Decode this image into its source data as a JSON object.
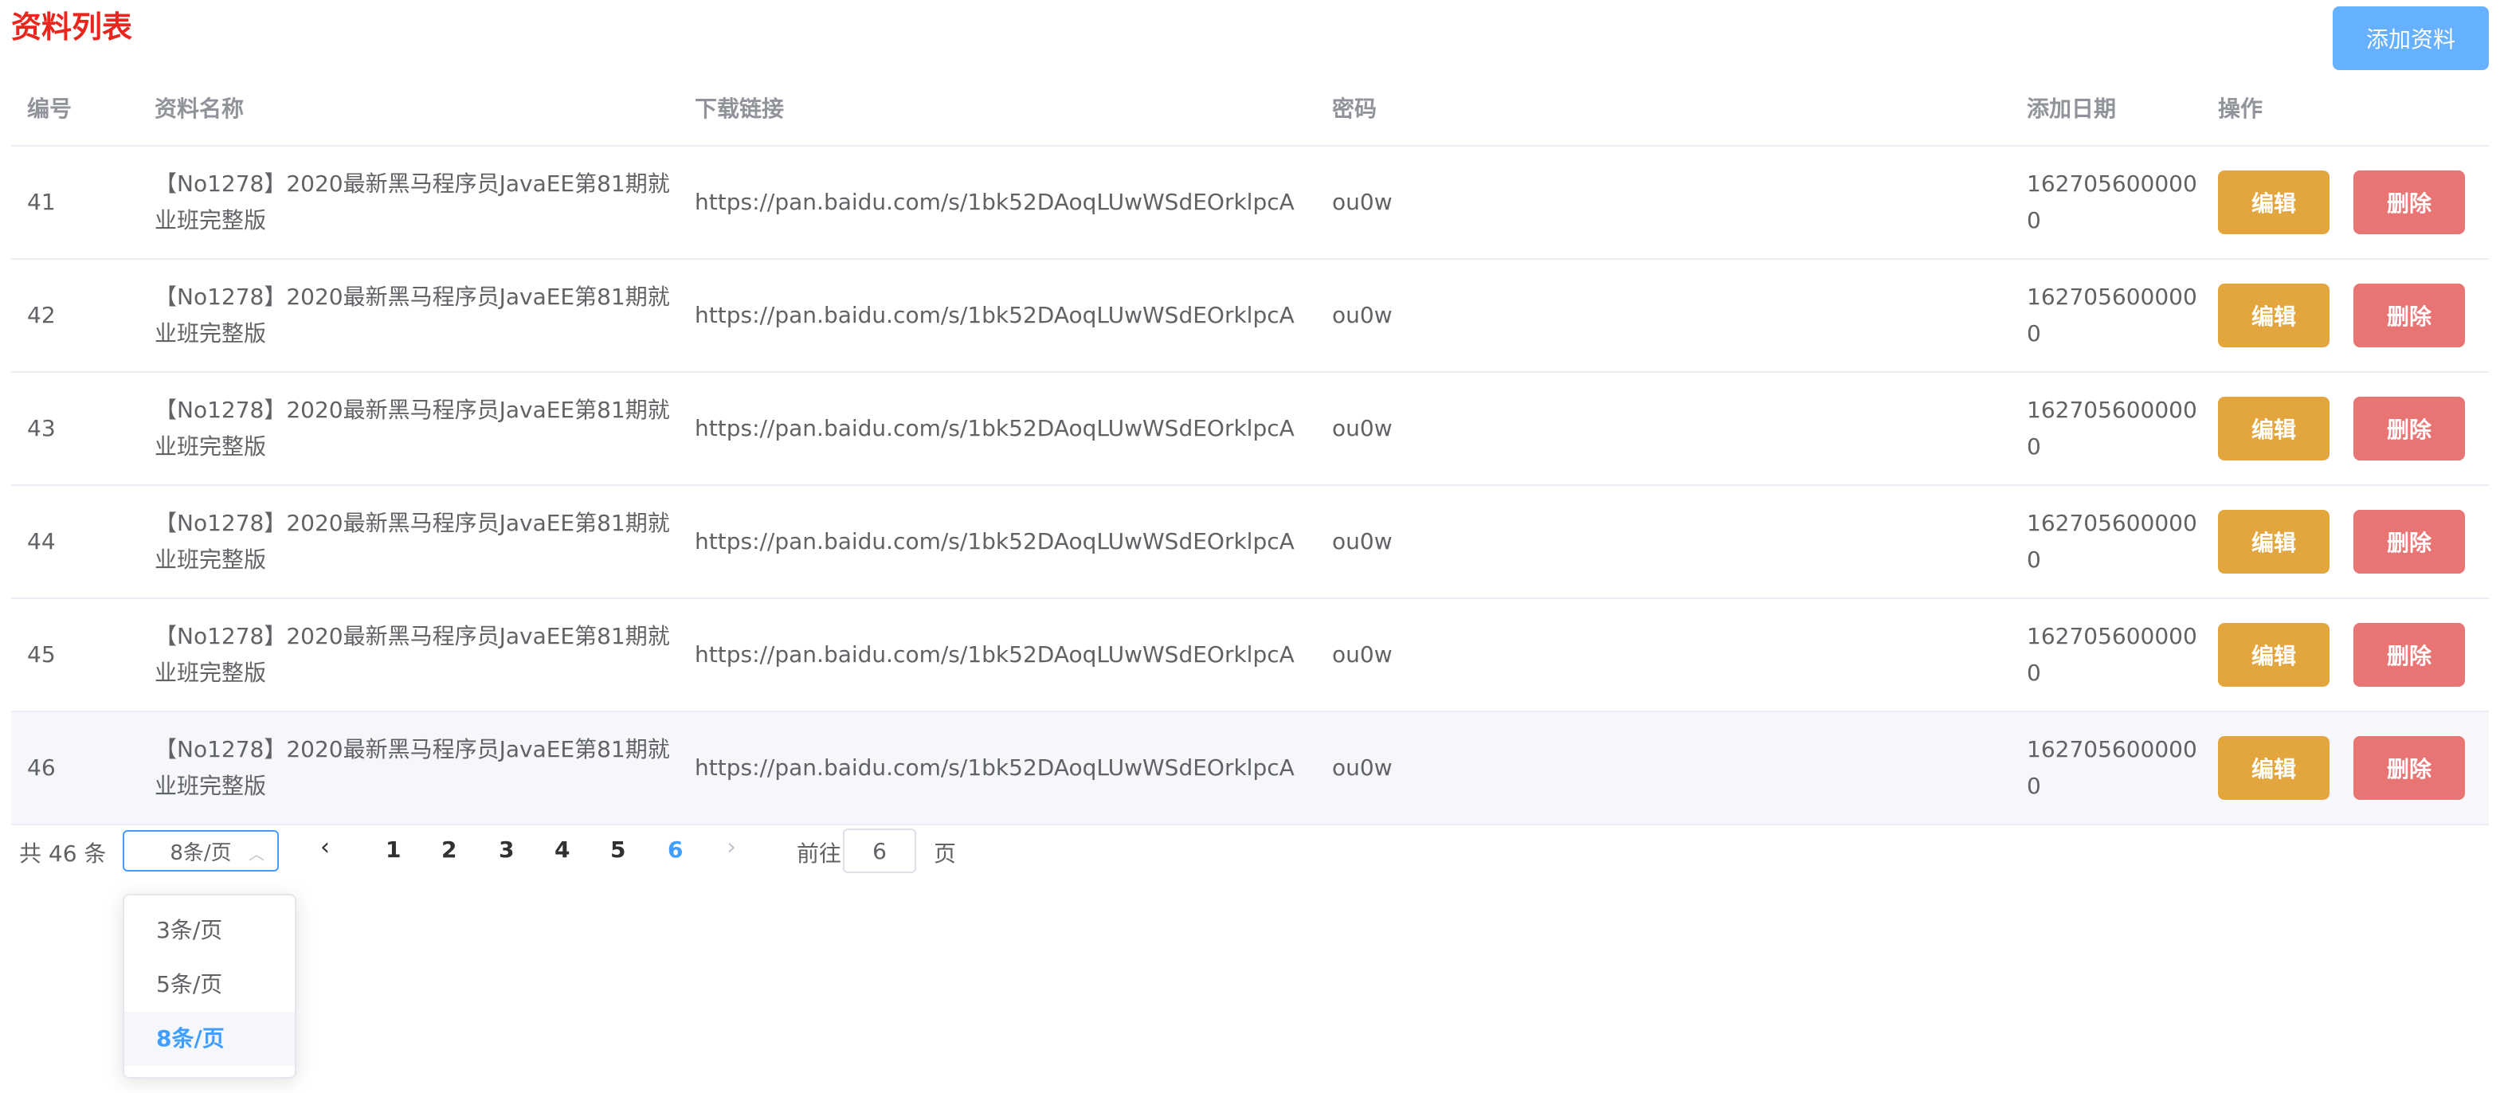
{
  "page_title": "资料列表",
  "add_button_label": "添加资料",
  "colors": {
    "title": "#e8261d",
    "primary": "#409eff",
    "add_button": "#66b1ff",
    "edit_button": "#e3a63e",
    "delete_button": "#e87474"
  },
  "table": {
    "headers": {
      "id": "编号",
      "name": "资料名称",
      "link": "下载链接",
      "password": "密码",
      "date": "添加日期",
      "ops": "操作"
    },
    "rows": [
      {
        "id": "41",
        "name": "【No1278】2020最新黑马程序员JavaEE第81期就业班完整版",
        "link": "https://pan.baidu.com/s/1bk52DAoqLUwWSdEOrklpcA",
        "password": "ou0w",
        "date": "1627056000000",
        "edit": "编辑",
        "delete": "删除"
      },
      {
        "id": "42",
        "name": "【No1278】2020最新黑马程序员JavaEE第81期就业班完整版",
        "link": "https://pan.baidu.com/s/1bk52DAoqLUwWSdEOrklpcA",
        "password": "ou0w",
        "date": "1627056000000",
        "edit": "编辑",
        "delete": "删除"
      },
      {
        "id": "43",
        "name": "【No1278】2020最新黑马程序员JavaEE第81期就业班完整版",
        "link": "https://pan.baidu.com/s/1bk52DAoqLUwWSdEOrklpcA",
        "password": "ou0w",
        "date": "1627056000000",
        "edit": "编辑",
        "delete": "删除"
      },
      {
        "id": "44",
        "name": "【No1278】2020最新黑马程序员JavaEE第81期就业班完整版",
        "link": "https://pan.baidu.com/s/1bk52DAoqLUwWSdEOrklpcA",
        "password": "ou0w",
        "date": "1627056000000",
        "edit": "编辑",
        "delete": "删除"
      },
      {
        "id": "45",
        "name": "【No1278】2020最新黑马程序员JavaEE第81期就业班完整版",
        "link": "https://pan.baidu.com/s/1bk52DAoqLUwWSdEOrklpcA",
        "password": "ou0w",
        "date": "1627056000000",
        "edit": "编辑",
        "delete": "删除"
      },
      {
        "id": "46",
        "name": "【No1278】2020最新黑马程序员JavaEE第81期就业班完整版",
        "link": "https://pan.baidu.com/s/1bk52DAoqLUwWSdEOrklpcA",
        "password": "ou0w",
        "date": "1627056000000",
        "edit": "编辑",
        "delete": "删除"
      }
    ]
  },
  "pagination": {
    "total_label": "共 46 条",
    "page_size_selected": "8条/页",
    "prev_icon": "‹",
    "next_icon": "›",
    "pages": [
      "1",
      "2",
      "3",
      "4",
      "5",
      "6"
    ],
    "current_page": "6",
    "jumper_prefix": "前往",
    "jumper_value": "6",
    "jumper_suffix": "页",
    "page_size_options": [
      "3条/页",
      "5条/页",
      "8条/页"
    ]
  }
}
